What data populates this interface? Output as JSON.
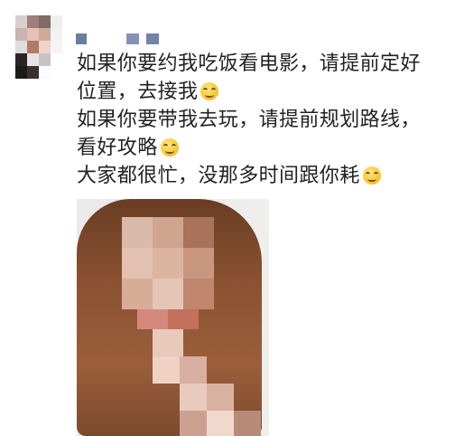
{
  "post": {
    "lines": [
      "如果你要约我吃饭看电影，请提前定好",
      "位置，去接我",
      "如果你要带我去玩，请提前规划路线，",
      "看好攻略",
      "大家都很忙，没那多时间跟你耗"
    ],
    "emoji_icon": "smiling-face-emoji"
  },
  "colors": {
    "text": "#222222",
    "nickname_block": "#5b6f98",
    "hair": "#8a5232"
  }
}
